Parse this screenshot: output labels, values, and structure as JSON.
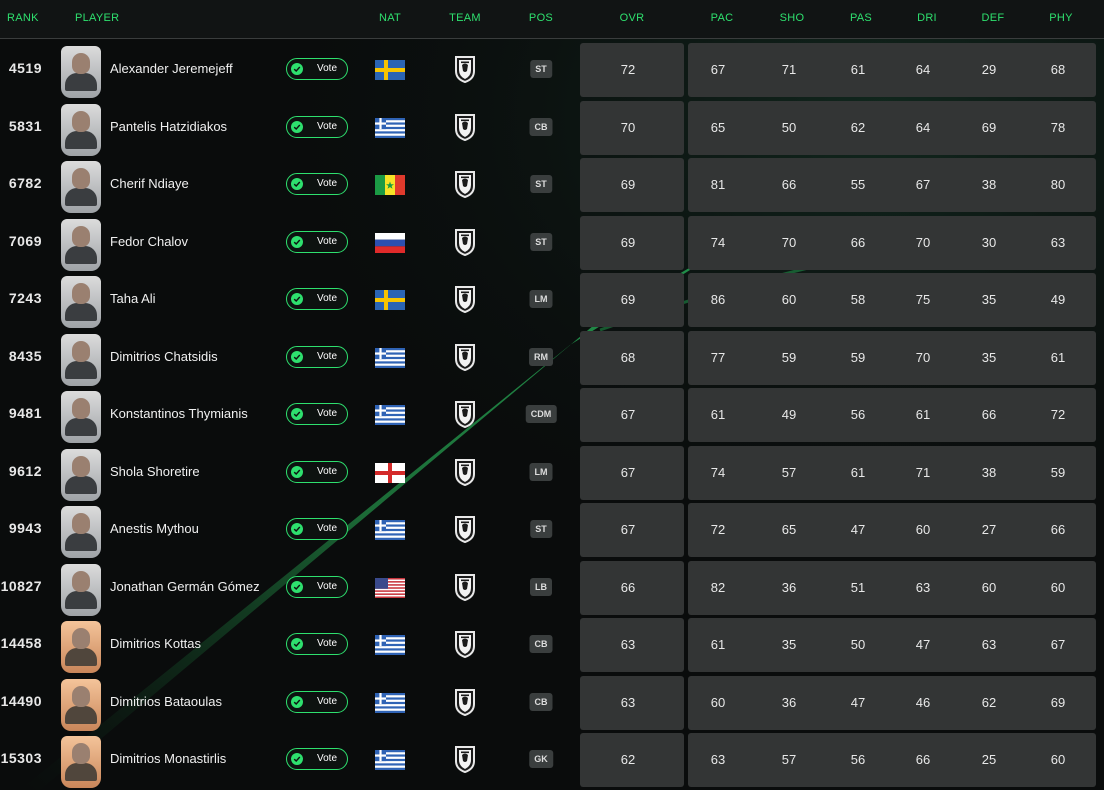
{
  "header": {
    "rank": "RANK",
    "player": "PLAYER",
    "nat": "NAT",
    "team": "TEAM",
    "pos": "POS",
    "ovr": "OVR",
    "pac": "PAC",
    "sho": "SHO",
    "pas": "PAS",
    "dri": "DRI",
    "def": "DEF",
    "phy": "PHY"
  },
  "colors": {
    "accent": "#2ee06e",
    "panel": "#333535",
    "background": "#0a0c0c"
  },
  "vote_label": "Vote",
  "players": [
    {
      "rank": "4519",
      "name": "Alexander Jeremejeff",
      "nat": "sweden",
      "pos": "ST",
      "card": "silver",
      "ovr": "72",
      "pac": "67",
      "sho": "71",
      "pas": "61",
      "dri": "64",
      "def": "29",
      "phy": "68"
    },
    {
      "rank": "5831",
      "name": "Pantelis Hatzidiakos",
      "nat": "greece",
      "pos": "CB",
      "card": "silver",
      "ovr": "70",
      "pac": "65",
      "sho": "50",
      "pas": "62",
      "dri": "64",
      "def": "69",
      "phy": "78"
    },
    {
      "rank": "6782",
      "name": "Cherif Ndiaye",
      "nat": "senegal",
      "pos": "ST",
      "card": "silver",
      "ovr": "69",
      "pac": "81",
      "sho": "66",
      "pas": "55",
      "dri": "67",
      "def": "38",
      "phy": "80"
    },
    {
      "rank": "7069",
      "name": "Fedor Chalov",
      "nat": "russia",
      "pos": "ST",
      "card": "silver",
      "ovr": "69",
      "pac": "74",
      "sho": "70",
      "pas": "66",
      "dri": "70",
      "def": "30",
      "phy": "63"
    },
    {
      "rank": "7243",
      "name": "Taha Ali",
      "nat": "sweden",
      "pos": "LM",
      "card": "silver",
      "ovr": "69",
      "pac": "86",
      "sho": "60",
      "pas": "58",
      "dri": "75",
      "def": "35",
      "phy": "49"
    },
    {
      "rank": "8435",
      "name": "Dimitrios Chatsidis",
      "nat": "greece",
      "pos": "RM",
      "card": "silver",
      "ovr": "68",
      "pac": "77",
      "sho": "59",
      "pas": "59",
      "dri": "70",
      "def": "35",
      "phy": "61"
    },
    {
      "rank": "9481",
      "name": "Konstantinos Thymianis",
      "nat": "greece",
      "pos": "CDM",
      "card": "silver",
      "ovr": "67",
      "pac": "61",
      "sho": "49",
      "pas": "56",
      "dri": "61",
      "def": "66",
      "phy": "72"
    },
    {
      "rank": "9612",
      "name": "Shola Shoretire",
      "nat": "england",
      "pos": "LM",
      "card": "silver",
      "ovr": "67",
      "pac": "74",
      "sho": "57",
      "pas": "61",
      "dri": "71",
      "def": "38",
      "phy": "59"
    },
    {
      "rank": "9943",
      "name": "Anestis Mythou",
      "nat": "greece",
      "pos": "ST",
      "card": "silver",
      "ovr": "67",
      "pac": "72",
      "sho": "65",
      "pas": "47",
      "dri": "60",
      "def": "27",
      "phy": "66"
    },
    {
      "rank": "10827",
      "name": "Jonathan Germán Gómez",
      "nat": "usa",
      "pos": "LB",
      "card": "silver",
      "ovr": "66",
      "pac": "82",
      "sho": "36",
      "pas": "51",
      "dri": "63",
      "def": "60",
      "phy": "60"
    },
    {
      "rank": "14458",
      "name": "Dimitrios Kottas",
      "nat": "greece",
      "pos": "CB",
      "card": "bronze",
      "ovr": "63",
      "pac": "61",
      "sho": "35",
      "pas": "50",
      "dri": "47",
      "def": "63",
      "phy": "67"
    },
    {
      "rank": "14490",
      "name": "Dimitrios Bataoulas",
      "nat": "greece",
      "pos": "CB",
      "card": "bronze",
      "ovr": "63",
      "pac": "60",
      "sho": "36",
      "pas": "47",
      "dri": "46",
      "def": "62",
      "phy": "69"
    },
    {
      "rank": "15303",
      "name": "Dimitrios Monastirlis",
      "nat": "greece",
      "pos": "GK",
      "card": "bronze",
      "ovr": "62",
      "pac": "63",
      "sho": "57",
      "pas": "56",
      "dri": "66",
      "def": "25",
      "phy": "60"
    }
  ]
}
